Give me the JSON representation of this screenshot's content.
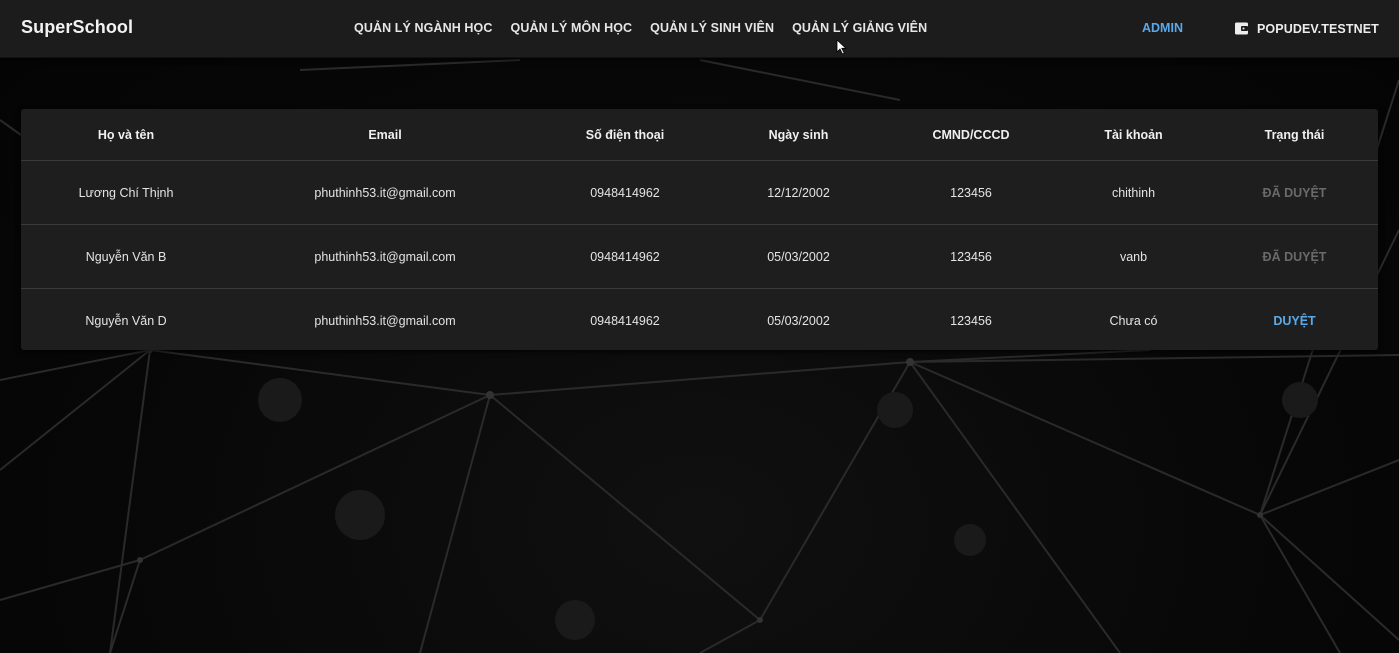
{
  "header": {
    "brand": "SuperSchool",
    "nav": [
      {
        "label": "QUẢN LÝ NGÀNH HỌC"
      },
      {
        "label": "QUẢN LÝ MÔN HỌC"
      },
      {
        "label": "QUẢN LÝ SINH VIÊN"
      },
      {
        "label": "QUẢN LÝ GIẢNG VIÊN"
      }
    ],
    "admin_label": "ADMIN",
    "account_label": "POPUDEV.TESTNET",
    "account_icon": "wallet-icon"
  },
  "table": {
    "columns": [
      "Họ và tên",
      "Email",
      "Số điện thoại",
      "Ngày sinh",
      "CMND/CCCD",
      "Tài khoản",
      "Trạng thái"
    ],
    "rows": [
      {
        "name": "Lương Chí Thịnh",
        "email": "phuthinh53.it@gmail.com",
        "phone": "0948414962",
        "dob": "12/12/2002",
        "id_number": "123456",
        "account": "chithinh",
        "status": "ĐÃ DUYỆT"
      },
      {
        "name": "Nguyễn Văn B",
        "email": "phuthinh53.it@gmail.com",
        "phone": "0948414962",
        "dob": "05/03/2002",
        "id_number": "123456",
        "account": "vanb",
        "status": "ĐÃ DUYỆT"
      },
      {
        "name": "Nguyễn Văn D",
        "email": "phuthinh53.it@gmail.com",
        "phone": "0948414962",
        "dob": "05/03/2002",
        "id_number": "123456",
        "account": "Chưa có",
        "status": "DUYỆT"
      }
    ]
  },
  "colors": {
    "accent": "#5aa9e8",
    "status_done": "#6a6a6a",
    "topbar": "#1c1c1c",
    "card": "#1e1e1e"
  }
}
